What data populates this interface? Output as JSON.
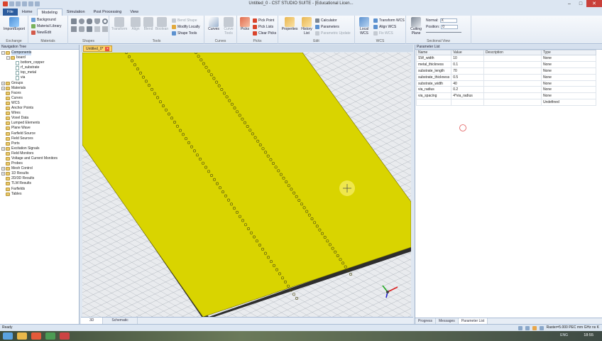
{
  "window": {
    "title": "Untitled_0 - CST STUDIO SUITE - [Educational Licen..."
  },
  "menu_tabs": [
    {
      "label": "File"
    },
    {
      "label": "Home"
    },
    {
      "label": "Modeling"
    },
    {
      "label": "Simulation"
    },
    {
      "label": "Post Processing"
    },
    {
      "label": "View"
    }
  ],
  "ribbon": {
    "exchange": {
      "label": "Exchange",
      "import_export": "Import/Export"
    },
    "materials": {
      "label": "Materials",
      "background": "Background",
      "material_library": "Material Library",
      "new_edit": "New/Edit"
    },
    "shapes": {
      "label": "Shapes"
    },
    "tools": {
      "label": "Tools",
      "transform": "Transform",
      "align": "Align",
      "blend": "Blend",
      "boolean": "Boolean",
      "bend_shape": "Bend Shape",
      "modify_locally": "Modify Locally",
      "shape_tools": "Shape Tools"
    },
    "curves": {
      "label": "Curves",
      "curves": "Curves",
      "curve_tools": "Curve Tools"
    },
    "picks": {
      "label": "Picks",
      "picks": "Picks",
      "pick_point": "Pick Point",
      "pick_lists": "Pick Lists",
      "clear_picks": "Clear Picks"
    },
    "edit": {
      "label": "Edit",
      "properties": "Properties",
      "history_list": "History List",
      "calculator": "Calculator",
      "parameters": "Parameters",
      "parametric_update": "Parametric Update"
    },
    "wcs": {
      "label": "WCS",
      "local_wcs": "Local WCS",
      "transform_wcs": "Transform WCS",
      "align_wcs": "Align WCS",
      "fix_wcs": "Fix WCS"
    },
    "sectional_view": {
      "label": "Sectional View",
      "cutting_plane": "Cutting Plane",
      "normal_label": "Normal:",
      "normal_value": "X",
      "position_label": "Position:",
      "position_value": "0"
    }
  },
  "nav": {
    "title": "Navigation Tree",
    "items": [
      {
        "label": "Components",
        "level": 0,
        "kind": "folder",
        "exp": "-",
        "selected": true
      },
      {
        "label": "board",
        "level": 1,
        "kind": "folder",
        "exp": "-"
      },
      {
        "label": "bottom_copper",
        "level": 2,
        "kind": "doc"
      },
      {
        "label": "rf_substrate",
        "level": 2,
        "kind": "doc"
      },
      {
        "label": "top_metal",
        "level": 2,
        "kind": "doc"
      },
      {
        "label": "via",
        "level": 2,
        "kind": "doc"
      },
      {
        "label": "Groups",
        "level": 0,
        "kind": "folder",
        "exp": "+"
      },
      {
        "label": "Materials",
        "level": 0,
        "kind": "folder",
        "exp": "+"
      },
      {
        "label": "Faces",
        "level": 0,
        "kind": "folder",
        "exp": ""
      },
      {
        "label": "Curves",
        "level": 0,
        "kind": "folder",
        "exp": ""
      },
      {
        "label": "WCS",
        "level": 0,
        "kind": "folder",
        "exp": ""
      },
      {
        "label": "Anchor Points",
        "level": 0,
        "kind": "folder",
        "exp": ""
      },
      {
        "label": "Wires",
        "level": 0,
        "kind": "folder",
        "exp": ""
      },
      {
        "label": "Voxel Data",
        "level": 0,
        "kind": "folder",
        "exp": ""
      },
      {
        "label": "Lumped Elements",
        "level": 0,
        "kind": "folder",
        "exp": ""
      },
      {
        "label": "Plane Wave",
        "level": 0,
        "kind": "folder",
        "exp": ""
      },
      {
        "label": "Farfield Source",
        "level": 0,
        "kind": "folder",
        "exp": ""
      },
      {
        "label": "Field Sources",
        "level": 0,
        "kind": "folder",
        "exp": ""
      },
      {
        "label": "Ports",
        "level": 0,
        "kind": "folder",
        "exp": ""
      },
      {
        "label": "Excitation Signals",
        "level": 0,
        "kind": "folder",
        "exp": "+"
      },
      {
        "label": "Field Monitors",
        "level": 0,
        "kind": "folder",
        "exp": ""
      },
      {
        "label": "Voltage and Current Monitors",
        "level": 0,
        "kind": "folder",
        "exp": ""
      },
      {
        "label": "Probes",
        "level": 0,
        "kind": "folder",
        "exp": ""
      },
      {
        "label": "Mesh Control",
        "level": 0,
        "kind": "folder",
        "exp": "+"
      },
      {
        "label": "1D Results",
        "level": 0,
        "kind": "folder",
        "exp": "+"
      },
      {
        "label": "2D/3D Results",
        "level": 0,
        "kind": "folder",
        "exp": ""
      },
      {
        "label": "TLM Results",
        "level": 0,
        "kind": "folder",
        "exp": ""
      },
      {
        "label": "Farfields",
        "level": 0,
        "kind": "folder",
        "exp": ""
      },
      {
        "label": "Tables",
        "level": 0,
        "kind": "folder",
        "exp": ""
      }
    ]
  },
  "doc_tab": {
    "label": "Untitled_0*"
  },
  "view_tabs": [
    {
      "label": "3D"
    },
    {
      "label": "Schematic"
    }
  ],
  "params": {
    "title": "Parameter List",
    "headers": [
      "Name",
      "Value",
      "Description",
      "Type"
    ],
    "rows": [
      [
        "SW_width",
        "10",
        "",
        "None"
      ],
      [
        "metal_thickness",
        "0.1",
        "",
        "None"
      ],
      [
        "substrate_length",
        "70",
        "",
        "None"
      ],
      [
        "substrate_thickness",
        "0.5",
        "",
        "None"
      ],
      [
        "substrate_width",
        "40",
        "",
        "None"
      ],
      [
        "via_radius",
        "0.2",
        "",
        "None"
      ],
      [
        "via_spacing",
        "4*via_radius",
        "",
        "None"
      ],
      [
        "",
        "",
        "",
        "Undefined"
      ]
    ],
    "bottom_tabs": [
      {
        "label": "Progress"
      },
      {
        "label": "Messages"
      },
      {
        "label": "Parameter List"
      }
    ]
  },
  "status": {
    "left": "Ready",
    "right": "Raster=5.000  PEC  mm  GHz  ns  K"
  },
  "taskbar": {
    "lang": "ENG",
    "time": "18:55"
  }
}
